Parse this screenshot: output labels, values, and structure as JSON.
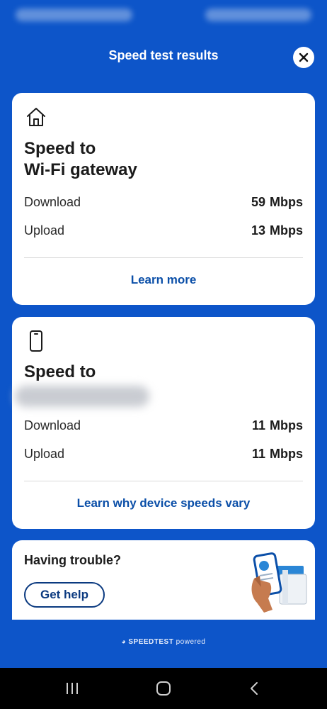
{
  "header": {
    "title": "Speed test results"
  },
  "gateway_card": {
    "title_line1": "Speed to",
    "title_line2": "Wi-Fi gateway",
    "download_label": "Download",
    "download_value": "59",
    "download_unit": "Mbps",
    "upload_label": "Upload",
    "upload_value": "13",
    "upload_unit": "Mbps",
    "link": "Learn more"
  },
  "device_card": {
    "title_line1": "Speed to",
    "download_label": "Download",
    "download_value": "11",
    "download_unit": "Mbps",
    "upload_label": "Upload",
    "upload_value": "11",
    "upload_unit": "Mbps",
    "link": "Learn why device speeds vary"
  },
  "trouble_card": {
    "title": "Having trouble?",
    "button": "Get help"
  },
  "footer": {
    "brand": "SPEEDTEST",
    "suffix": "powered"
  },
  "colors": {
    "background": "#0d55c9",
    "link": "#0b4fa8",
    "card": "#ffffff"
  },
  "icons": {
    "close": "close-icon",
    "gateway": "home-icon",
    "device": "phone-icon",
    "nav_recent": "recent-apps-icon",
    "nav_home": "home-button-icon",
    "nav_back": "back-icon"
  }
}
